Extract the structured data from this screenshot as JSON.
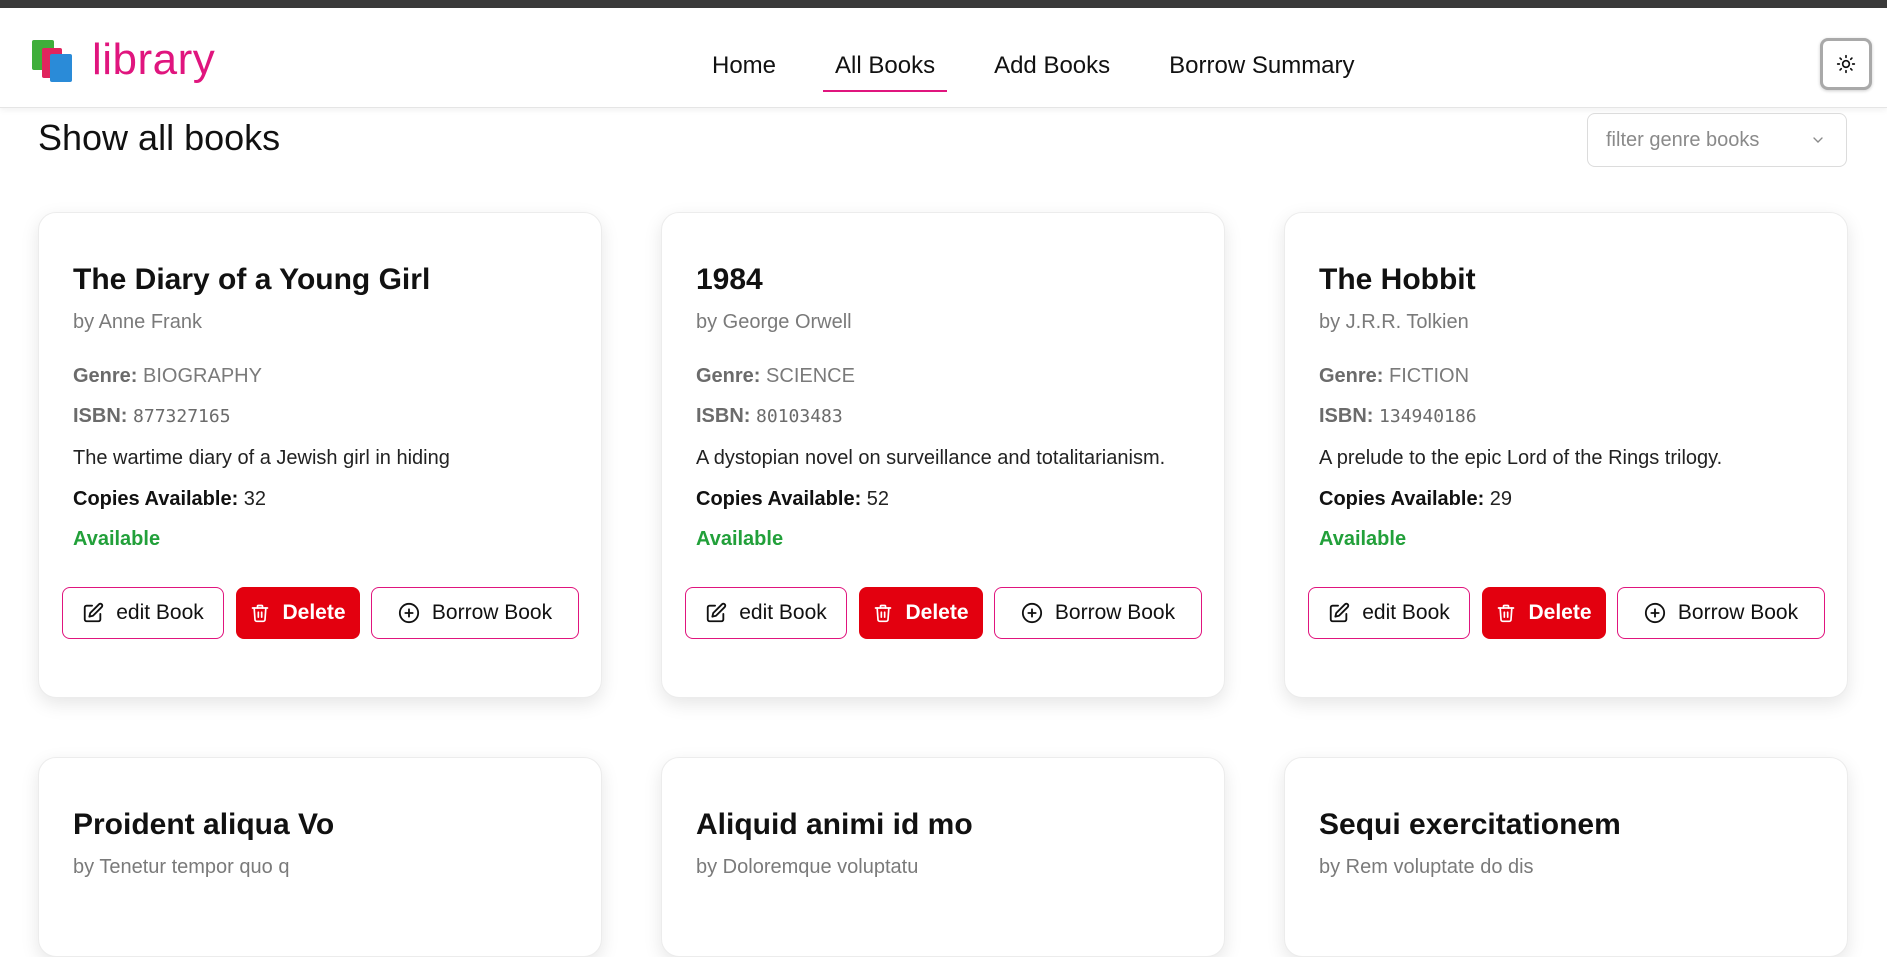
{
  "app": {
    "name": "library"
  },
  "nav": {
    "links": [
      {
        "label": "Home",
        "active": false
      },
      {
        "label": "All Books",
        "active": true
      },
      {
        "label": "Add Books",
        "active": false
      },
      {
        "label": "Borrow Summary",
        "active": false
      }
    ]
  },
  "page": {
    "title": "Show all books"
  },
  "filter": {
    "placeholder": "filter genre books"
  },
  "labels": {
    "genre": "Genre:",
    "isbn": "ISBN:",
    "copies": "Copies Available:",
    "edit": "edit Book",
    "delete": "Delete",
    "borrow": "Borrow Book"
  },
  "books": [
    {
      "title": "The Diary of a Young Girl",
      "author": "by Anne Frank",
      "genre": "BIOGRAPHY",
      "isbn": "877327165",
      "description": "The wartime diary of a Jewish girl in hiding",
      "copies": "32",
      "status": "Available"
    },
    {
      "title": "1984",
      "author": "by George Orwell",
      "genre": "SCIENCE",
      "isbn": "80103483",
      "description": "A dystopian novel on surveillance and totalitarianism.",
      "copies": "52",
      "status": "Available"
    },
    {
      "title": "The Hobbit",
      "author": "by J.R.R. Tolkien",
      "genre": "FICTION",
      "isbn": "134940186",
      "description": "A prelude to the epic Lord of the Rings trilogy.",
      "copies": "29",
      "status": "Available"
    },
    {
      "title": "Proident aliqua Vo",
      "author": "by Tenetur tempor quo q"
    },
    {
      "title": "Aliquid animi id mo",
      "author": "by Doloremque voluptatu"
    },
    {
      "title": "Sequi exercitationem",
      "author": "by Rem voluptate do dis"
    }
  ],
  "colors": {
    "brand": "#e0157e",
    "danger": "#e3000f",
    "available": "#22a03a"
  }
}
